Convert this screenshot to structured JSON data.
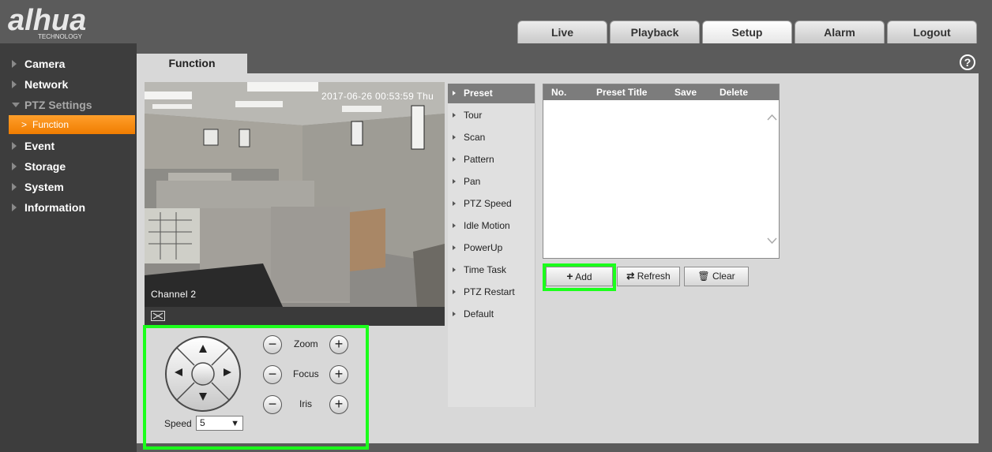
{
  "brand": {
    "logo_text": "alhua",
    "logo_sub": "TECHNOLOGY"
  },
  "top_tabs": [
    {
      "label": "Live"
    },
    {
      "label": "Playback"
    },
    {
      "label": "Setup",
      "active": true
    },
    {
      "label": "Alarm"
    },
    {
      "label": "Logout"
    }
  ],
  "sidebar": {
    "items": [
      {
        "label": "Camera"
      },
      {
        "label": "Network"
      },
      {
        "label": "PTZ Settings",
        "expanded": true
      },
      {
        "label": "Event"
      },
      {
        "label": "Storage"
      },
      {
        "label": "System"
      },
      {
        "label": "Information"
      }
    ],
    "sub_item": {
      "label": "Function",
      "active": true
    }
  },
  "page": {
    "tab_title": "Function",
    "help_label": "?"
  },
  "video": {
    "timestamp": "2017-06-26 00:53:59 Thu",
    "channel": "Channel 2"
  },
  "ptz": {
    "zoom_label": "Zoom",
    "focus_label": "Focus",
    "iris_label": "Iris",
    "minus": "−",
    "plus": "+",
    "speed_label": "Speed",
    "speed_value": "5",
    "speed_arrow": "▼"
  },
  "menu": {
    "items": [
      {
        "label": "Preset",
        "active": true
      },
      {
        "label": "Tour"
      },
      {
        "label": "Scan"
      },
      {
        "label": "Pattern"
      },
      {
        "label": "Pan"
      },
      {
        "label": "PTZ Speed"
      },
      {
        "label": "Idle Motion"
      },
      {
        "label": "PowerUp"
      },
      {
        "label": "Time Task"
      },
      {
        "label": "PTZ Restart"
      },
      {
        "label": "Default"
      }
    ]
  },
  "preset_table": {
    "columns": [
      "No.",
      "Preset Title",
      "Save",
      "Delete"
    ],
    "rows": []
  },
  "buttons": {
    "add": "Add",
    "refresh": "Refresh",
    "clear": "Clear"
  },
  "colors": {
    "accent_orange": "#f08a0e",
    "highlight_green": "#1bff1b",
    "header_gray": "#5b5b5b",
    "sidebar_dark": "#3d3d3d"
  }
}
